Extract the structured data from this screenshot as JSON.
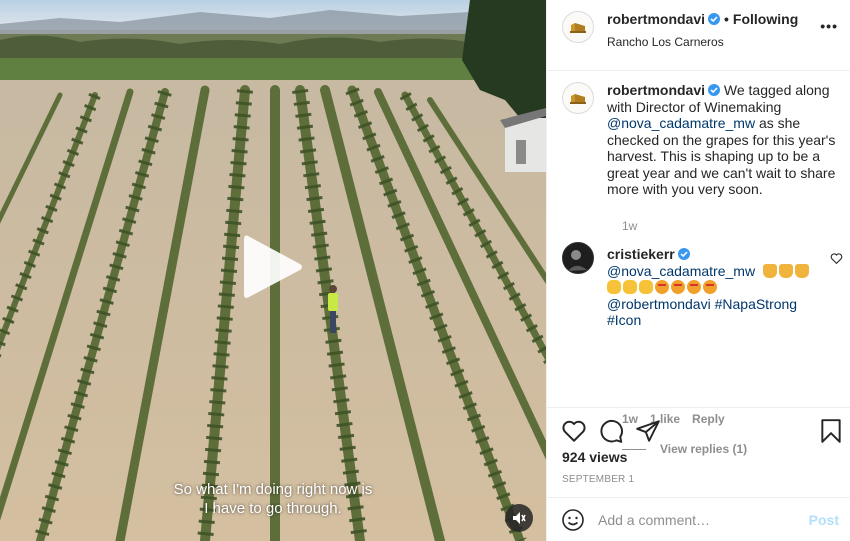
{
  "media": {
    "subtitle_line1": "So what I'm doing right now is",
    "subtitle_line2": "I have to go through."
  },
  "header": {
    "username": "robertmondavi",
    "separator": "•",
    "follow_status": "Following",
    "location": "Rancho Los Carneros",
    "more_label": "•••"
  },
  "caption": {
    "username": "robertmondavi",
    "text_before": "We tagged along with Director of Winemaking",
    "mention": "@nova_cadamatre_mw",
    "text_after": "as she checked on the grapes for this year's harvest. This is shaping up to be a great year and we can't wait to share more with you very soon.",
    "time": "1w"
  },
  "comment": {
    "username": "cristiekerr",
    "mention1": "@nova_cadamatre_mw",
    "mention2": "@robertmondavi",
    "hashtag1": "#NapaStrong",
    "hashtag2": "#Icon",
    "time": "1w",
    "likes": "1 like",
    "reply_label": "Reply",
    "view_replies": "View replies (1)"
  },
  "actions": {
    "views": "924 views",
    "date": "SEPTEMBER 1"
  },
  "add_comment": {
    "placeholder": "Add a comment…",
    "post_label": "Post"
  },
  "colors": {
    "verified": "#3897f0",
    "link": "#00376b",
    "meta": "#8e8e8e",
    "post_disabled": "#b2dffc"
  },
  "icons": [
    "play-icon",
    "mute-icon",
    "verified-badge-icon",
    "heart-icon",
    "comment-icon",
    "share-icon",
    "bookmark-icon",
    "smiley-icon",
    "more-icon"
  ]
}
